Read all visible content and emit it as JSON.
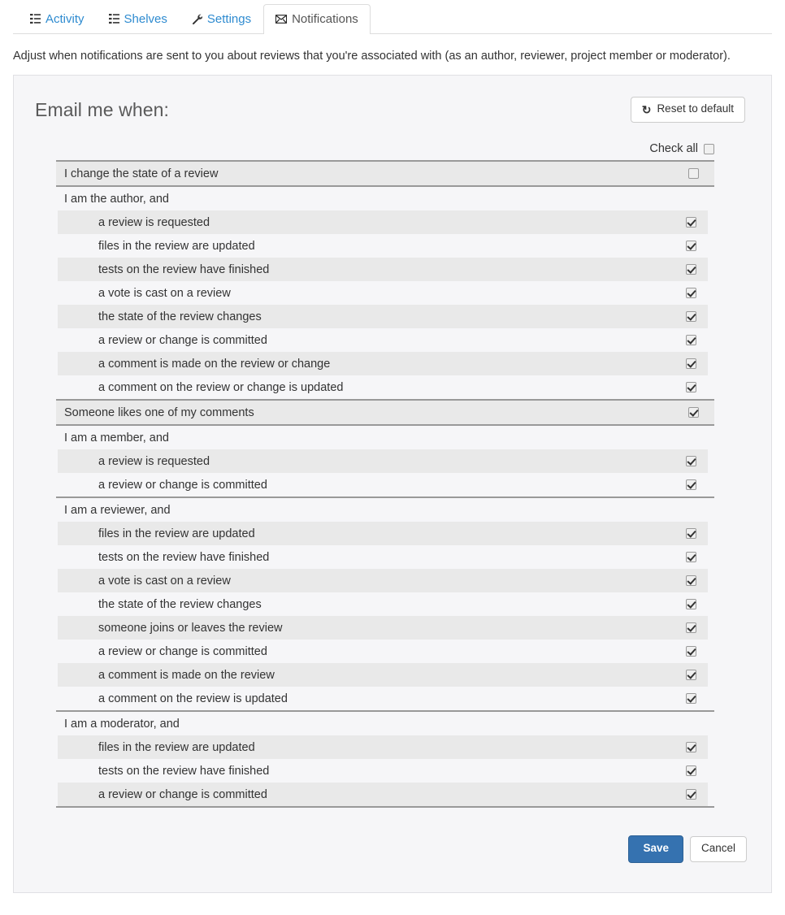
{
  "tabs": [
    {
      "label": "Activity",
      "icon": "list-icon",
      "active": false
    },
    {
      "label": "Shelves",
      "icon": "list-grid-icon",
      "active": false
    },
    {
      "label": "Settings",
      "icon": "wrench-icon",
      "active": false
    },
    {
      "label": "Notifications",
      "icon": "envelope-icon",
      "active": true
    }
  ],
  "intro": "Adjust when notifications are sent to you about reviews that you're associated with (as an author, reviewer, project member or moderator).",
  "panel": {
    "title": "Email me when:",
    "reset_button": "Reset to default",
    "reset_icon": "refresh-icon",
    "check_all_label": "Check all",
    "check_all_checked": false,
    "groups": [
      {
        "kind": "single",
        "rows": [
          {
            "label": "I change the state of a review",
            "checked": false,
            "indent": false
          }
        ]
      },
      {
        "kind": "group",
        "header": "I am the author, and",
        "rows": [
          {
            "label": "a review is requested",
            "checked": true,
            "indent": true
          },
          {
            "label": "files in the review are updated",
            "checked": true,
            "indent": true
          },
          {
            "label": "tests on the review have finished",
            "checked": true,
            "indent": true
          },
          {
            "label": "a vote is cast on a review",
            "checked": true,
            "indent": true
          },
          {
            "label": "the state of the review changes",
            "checked": true,
            "indent": true
          },
          {
            "label": "a review or change is committed",
            "checked": true,
            "indent": true
          },
          {
            "label": "a comment is made on the review or change",
            "checked": true,
            "indent": true
          },
          {
            "label": "a comment on the review or change is updated",
            "checked": true,
            "indent": true
          }
        ]
      },
      {
        "kind": "single",
        "rows": [
          {
            "label": "Someone likes one of my comments",
            "checked": true,
            "indent": false
          }
        ]
      },
      {
        "kind": "group",
        "header": "I am a member, and",
        "rows": [
          {
            "label": "a review is requested",
            "checked": true,
            "indent": true
          },
          {
            "label": "a review or change is committed",
            "checked": true,
            "indent": true
          }
        ]
      },
      {
        "kind": "group",
        "header": "I am a reviewer, and",
        "rows": [
          {
            "label": "files in the review are updated",
            "checked": true,
            "indent": true
          },
          {
            "label": "tests on the review have finished",
            "checked": true,
            "indent": true
          },
          {
            "label": "a vote is cast on a review",
            "checked": true,
            "indent": true
          },
          {
            "label": "the state of the review changes",
            "checked": true,
            "indent": true
          },
          {
            "label": "someone joins or leaves the review",
            "checked": true,
            "indent": true
          },
          {
            "label": "a review or change is committed",
            "checked": true,
            "indent": true
          },
          {
            "label": "a comment is made on the review",
            "checked": true,
            "indent": true
          },
          {
            "label": "a comment on the review is updated",
            "checked": true,
            "indent": true
          }
        ]
      },
      {
        "kind": "group",
        "header": "I am a moderator, and",
        "rows": [
          {
            "label": "files in the review are updated",
            "checked": true,
            "indent": true
          },
          {
            "label": "tests on the review have finished",
            "checked": true,
            "indent": true
          },
          {
            "label": "a review or change is committed",
            "checked": true,
            "indent": true
          }
        ]
      }
    ],
    "save_button": "Save",
    "cancel_button": "Cancel"
  },
  "colors": {
    "tab_link": "#2e8bd0",
    "primary_button": "#3572b0",
    "panel_bg": "#f6f6f8",
    "row_alt": "#e9e9e9",
    "group_rule": "#999999"
  }
}
